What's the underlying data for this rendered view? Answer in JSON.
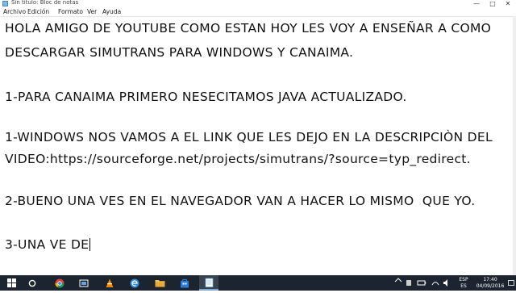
{
  "window": {
    "title": "Sin título: Bloc de notas",
    "minimize_glyph": "—",
    "maximize_glyph": "□",
    "close_glyph": "✕"
  },
  "menu": {
    "items": [
      "Archivo",
      "Edición",
      "Formato",
      "Ver",
      "Ayuda"
    ]
  },
  "document": {
    "lines": [
      "HOLA AMIGO DE YOUTUBE COMO ESTAN HOY LES VOY A ENSEÑAR A COMO",
      "DESCARGAR SIMUTRANS PARA WINDOWS Y CANAIMA.",
      "",
      "1-PARA CANAIMA PRIMERO NESECITAMOS JAVA ACTUALIZADO.",
      "",
      "1-WINDOWS NOS VAMOS A EL LINK QUE LES DEJO EN LA DESCRIPCIÒN DEL",
      "VIDEO:https://sourceforge.net/projects/simutrans/?source=typ_redirect.",
      "",
      "2-BUENO UNA VES EN EL NAVEGADOR VAN A HACER LO MISMO  QUE YO.",
      "",
      "3-UNA VE DE"
    ]
  },
  "taskbar": {
    "start_icon": "windows-logo-icon",
    "search_icon": "cortana-search-icon",
    "apps": [
      "chrome-icon",
      "task-view-icon",
      "vlc-icon",
      "edge-icon",
      "file-explorer-icon",
      "store-icon",
      "notepad-icon"
    ],
    "tray": {
      "lang_top": "ESP",
      "lang_bottom": "ES",
      "time": "17:40",
      "date": "04/09/2016"
    }
  }
}
